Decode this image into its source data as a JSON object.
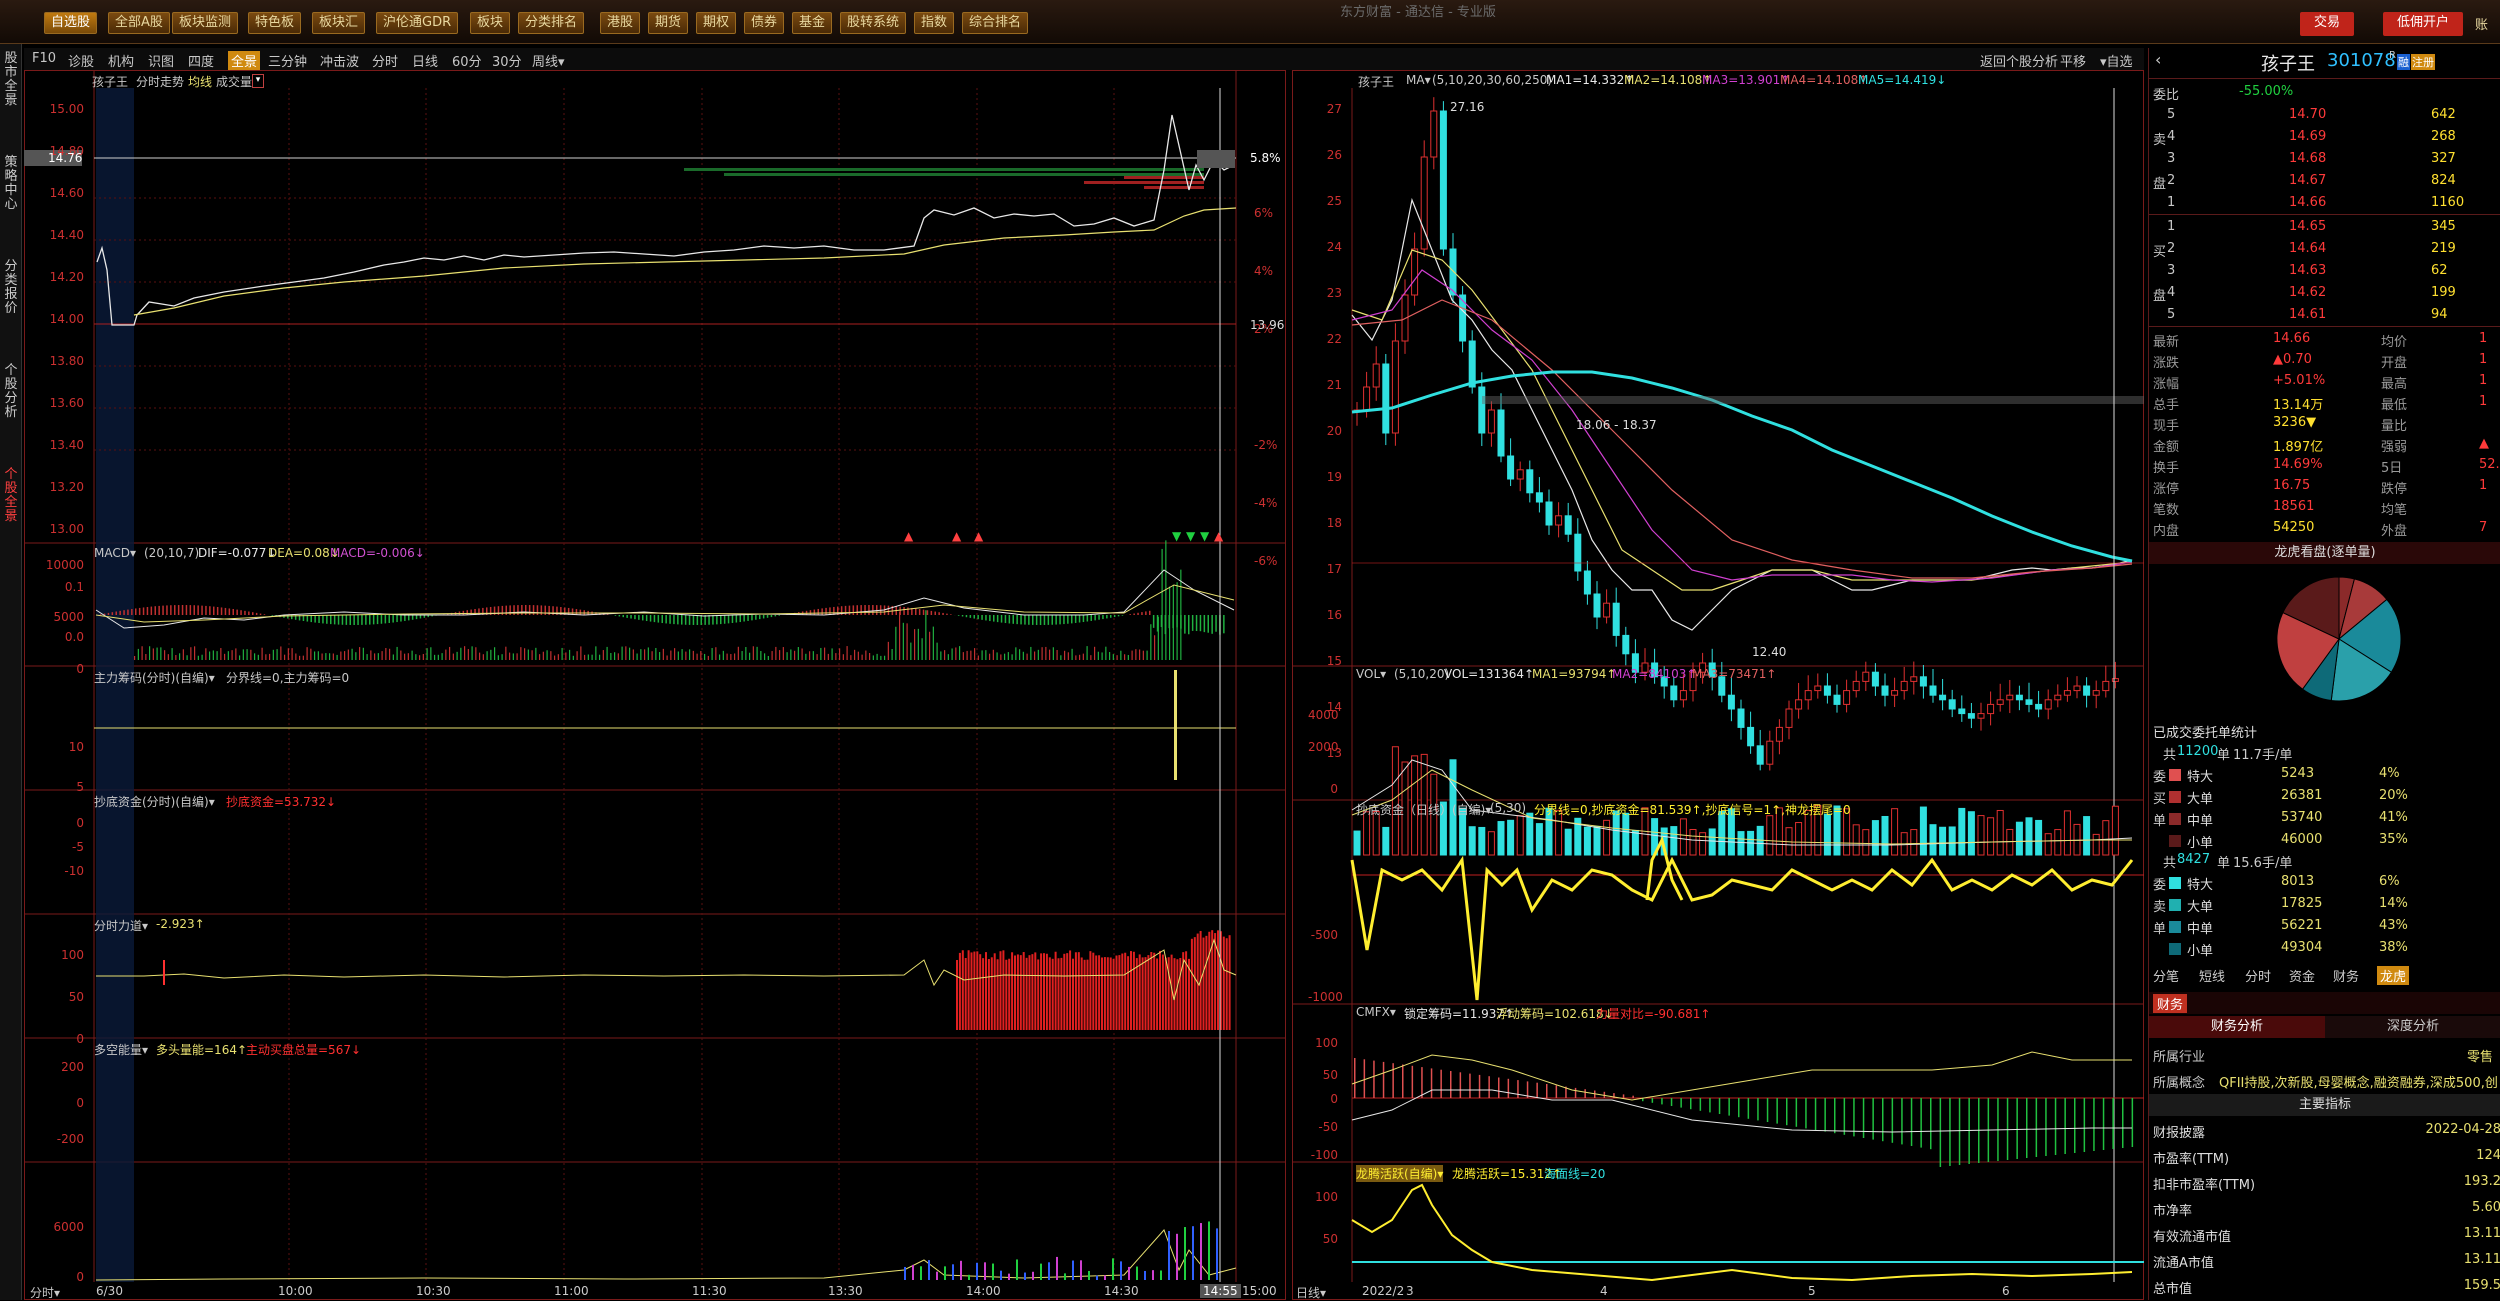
{
  "app": {
    "title": "东方财富 - 通达信 - 专业版"
  },
  "menu": [
    "自选股",
    "全部A股",
    "板块监测",
    "特色板",
    "板块汇",
    "沪伦通GDR",
    "板块",
    "分类排名",
    "港股",
    "期货",
    "期权",
    "债券",
    "基金",
    "股转系统",
    "指数",
    "综合排名"
  ],
  "topright": {
    "trade": "交易",
    "open_account": "低佣开户",
    "extra": "账"
  },
  "tools": {
    "items": [
      "F10",
      "诊股",
      "机构",
      "识图",
      "四度",
      "全景",
      "三分钟",
      "冲击波",
      "分时",
      "日线",
      "60分",
      "30分",
      "周线▾"
    ],
    "selected": "全景",
    "right": [
      "返回个股分析",
      "平移",
      "▾自选",
      "▾",
      "✕"
    ]
  },
  "sidebar": [
    "股市全景",
    "策略中心",
    "分类报价",
    "个股分析",
    "个股全景"
  ],
  "intraday": {
    "title": "孩子王",
    "chart_label": "分时走势",
    "avg_label": "均线",
    "vol_label": "成交量",
    "price_ticks": [
      "15.00",
      "14.80",
      "14.60",
      "14.40",
      "14.20",
      "14.00",
      "13.80",
      "13.60",
      "13.40",
      "13.20",
      "13.00"
    ],
    "current_price": "14.76",
    "pct_ticks": [
      "6%",
      "4%",
      "2%",
      "",
      "-2%",
      "-4%",
      "-6%"
    ],
    "current_pct": "5.8%",
    "base_price": "13.96",
    "vol_ticks": [
      "10000",
      "5000",
      "0"
    ],
    "times": [
      "6/30",
      "10:00",
      "10:30",
      "11:00",
      "11:30",
      "13:30",
      "14:00",
      "14:30",
      "14:55",
      "15:00"
    ],
    "bottom_left": "分时▾",
    "macd": {
      "title": "MACD▾",
      "params": "(20,10,7)",
      "dif": "DIF=-0.077↓",
      "dea": "DEA=0.08↓",
      "macd": "MACD=-0.006↓",
      "ticks": [
        "0.1",
        "0.0"
      ]
    },
    "main_funds": {
      "title": "主力筹码(分时)(自编)▾",
      "line": "分界线=0,主力筹码=0",
      "ticks": [
        "10",
        "5",
        "0",
        "-5",
        "-10"
      ]
    },
    "bottom_funds": {
      "title": "抄底资金(分时)(自编)▾",
      "line": "抄底资金=53.732↓",
      "ticks": [
        "100",
        "50",
        "0"
      ]
    },
    "power": {
      "title": "分时力道▾",
      "line": "-2.923↑",
      "ticks": [
        "200",
        "0",
        "-200"
      ]
    },
    "long_short": {
      "title": "多空能量▾",
      "line1": "多头量能=164↑",
      "line2": "主动买盘总量=567↓",
      "ticks": [
        "6000",
        "0"
      ]
    }
  },
  "daily": {
    "title": "孩子王",
    "ma_label": "MA▾",
    "ma_params": "(5,10,20,30,60,250)",
    "ma_values": [
      "MA1=14.332↑",
      "MA2=14.108↑",
      "MA3=13.901↑",
      "MA4=14.108↑",
      "MA5=14.419↓"
    ],
    "price_ticks": [
      "27",
      "26",
      "25",
      "24",
      "23",
      "22",
      "21",
      "20",
      "19",
      "18",
      "17",
      "16",
      "15",
      "14",
      "13"
    ],
    "high_label": "27.16",
    "low_label": "12.40",
    "range_label": "18.06 - 18.37",
    "dates": [
      "2022/2",
      "3",
      "4",
      "5",
      "6"
    ],
    "bottom_left": "日线▾",
    "vol": {
      "title": "VOL▾",
      "params": "(5,10,20)",
      "line": "VOL=131364↑",
      "ma1": "MA1=93794↑",
      "ma2": "MA2=84103↑",
      "ma3": "MA3=73471↑",
      "ticks": [
        "4000",
        "2000",
        "0"
      ]
    },
    "bottom_funds": {
      "title": "抄底资金（日线）(自编)▾",
      "params": "(5,30)",
      "line": "分界线=0,抄底资金=81.539↑,抄底信号=1↑,神龙摆尾=0",
      "ticks": [
        "-500",
        "-1000"
      ]
    },
    "cmfx": {
      "title": "CMFX▾",
      "line1": "锁定筹码=11.937↑",
      "line2": "浮动筹码=102.618↓",
      "line3": "力量对比=-90.681↑",
      "ticks": [
        "100",
        "50",
        "0",
        "-50",
        "-100"
      ]
    },
    "dragon": {
      "title": "龙腾活跃(自编)▾",
      "line1": "龙腾活跃=15.312↑",
      "line2": "海面线=20",
      "ticks": [
        "100",
        "50"
      ]
    }
  },
  "quote": {
    "name": "孩子王",
    "code": "301078",
    "badges": [
      "R",
      "融",
      "注册"
    ],
    "weibi": "委比",
    "weibi_val": "-55.00%",
    "asks": [
      [
        "5",
        "14.70",
        "642"
      ],
      [
        "4",
        "14.69",
        "268"
      ],
      [
        "3",
        "14.68",
        "327"
      ],
      [
        "2",
        "14.67",
        "824"
      ],
      [
        "1",
        "14.66",
        "1160"
      ]
    ],
    "bids": [
      [
        "1",
        "14.65",
        "345"
      ],
      [
        "2",
        "14.64",
        "219"
      ],
      [
        "3",
        "14.63",
        "62"
      ],
      [
        "4",
        "14.62",
        "199"
      ],
      [
        "5",
        "14.61",
        "94"
      ]
    ],
    "sell_label": "卖",
    "buy_label": "买",
    "pan_label": "盘",
    "stats": [
      [
        "最新",
        "14.66",
        "均价",
        "1"
      ],
      [
        "涨跌",
        "▲0.70",
        "开盘",
        "1"
      ],
      [
        "涨幅",
        "+5.01%",
        "最高",
        "1"
      ],
      [
        "总手",
        "13.14万",
        "最低",
        "1"
      ],
      [
        "现手",
        "3236▼",
        "量比",
        ""
      ],
      [
        "金额",
        "1.897亿",
        "强弱",
        "▲"
      ],
      [
        "换手",
        "14.69%",
        "5日",
        "52."
      ],
      [
        "涨停",
        "16.75",
        "跌停",
        "1"
      ],
      [
        "笔数",
        "18561",
        "均笔",
        ""
      ],
      [
        "内盘",
        "54250",
        "外盘",
        "7"
      ]
    ],
    "dragon_title": "龙虎看盘(逐单量)",
    "pie_colors": [
      "#8b2a2a",
      "#a83a3a",
      "#1a8a9a",
      "#2aa0aa",
      "#0e6a78",
      "#c04040",
      "#5a1a1a"
    ],
    "order_stats": "已成交委托单统计",
    "buy_group": {
      "total_prefix": "共",
      "total": "11200",
      "mid": "单",
      "avg": "11.7手/单",
      "side": [
        "委",
        "买",
        "单",
        ""
      ],
      "rows": [
        [
          "特大",
          "5243",
          "4%"
        ],
        [
          "大单",
          "26381",
          "20%"
        ],
        [
          "中单",
          "53740",
          "41%"
        ],
        [
          "小单",
          "46000",
          "35%"
        ]
      ]
    },
    "sell_group": {
      "total_prefix": "共",
      "total": "8427",
      "mid": "单",
      "avg": "15.6手/单",
      "side": [
        "委",
        "卖",
        "单",
        ""
      ],
      "rows": [
        [
          "特大",
          "8013",
          "6%"
        ],
        [
          "大单",
          "17825",
          "14%"
        ],
        [
          "中单",
          "56221",
          "43%"
        ],
        [
          "小单",
          "49304",
          "38%"
        ]
      ]
    },
    "tabs": [
      "分笔",
      "短线",
      "分时",
      "资金",
      "财务",
      "龙虎"
    ],
    "active_tab": "龙虎",
    "fin_tab": "财务",
    "fin_analysis": "财务分析",
    "depth_analysis": "深度分析",
    "industry_label": "所属行业",
    "industry_val": "零售",
    "concept_label": "所属概念",
    "concept_val": "QFII持股,次新股,母婴概念,融资融券,深成500,创",
    "main_index": "主要指标",
    "metrics": [
      [
        "财报披露",
        "2022-04-28"
      ],
      [
        "市盈率(TTM)",
        "124"
      ],
      [
        "扣非市盈率(TTM)",
        "193.2"
      ],
      [
        "市净率",
        "5.60"
      ],
      [
        "有效流通市值",
        "13.11"
      ],
      [
        "流通A市值",
        "13.11"
      ],
      [
        "总市值",
        "159.5"
      ]
    ]
  }
}
